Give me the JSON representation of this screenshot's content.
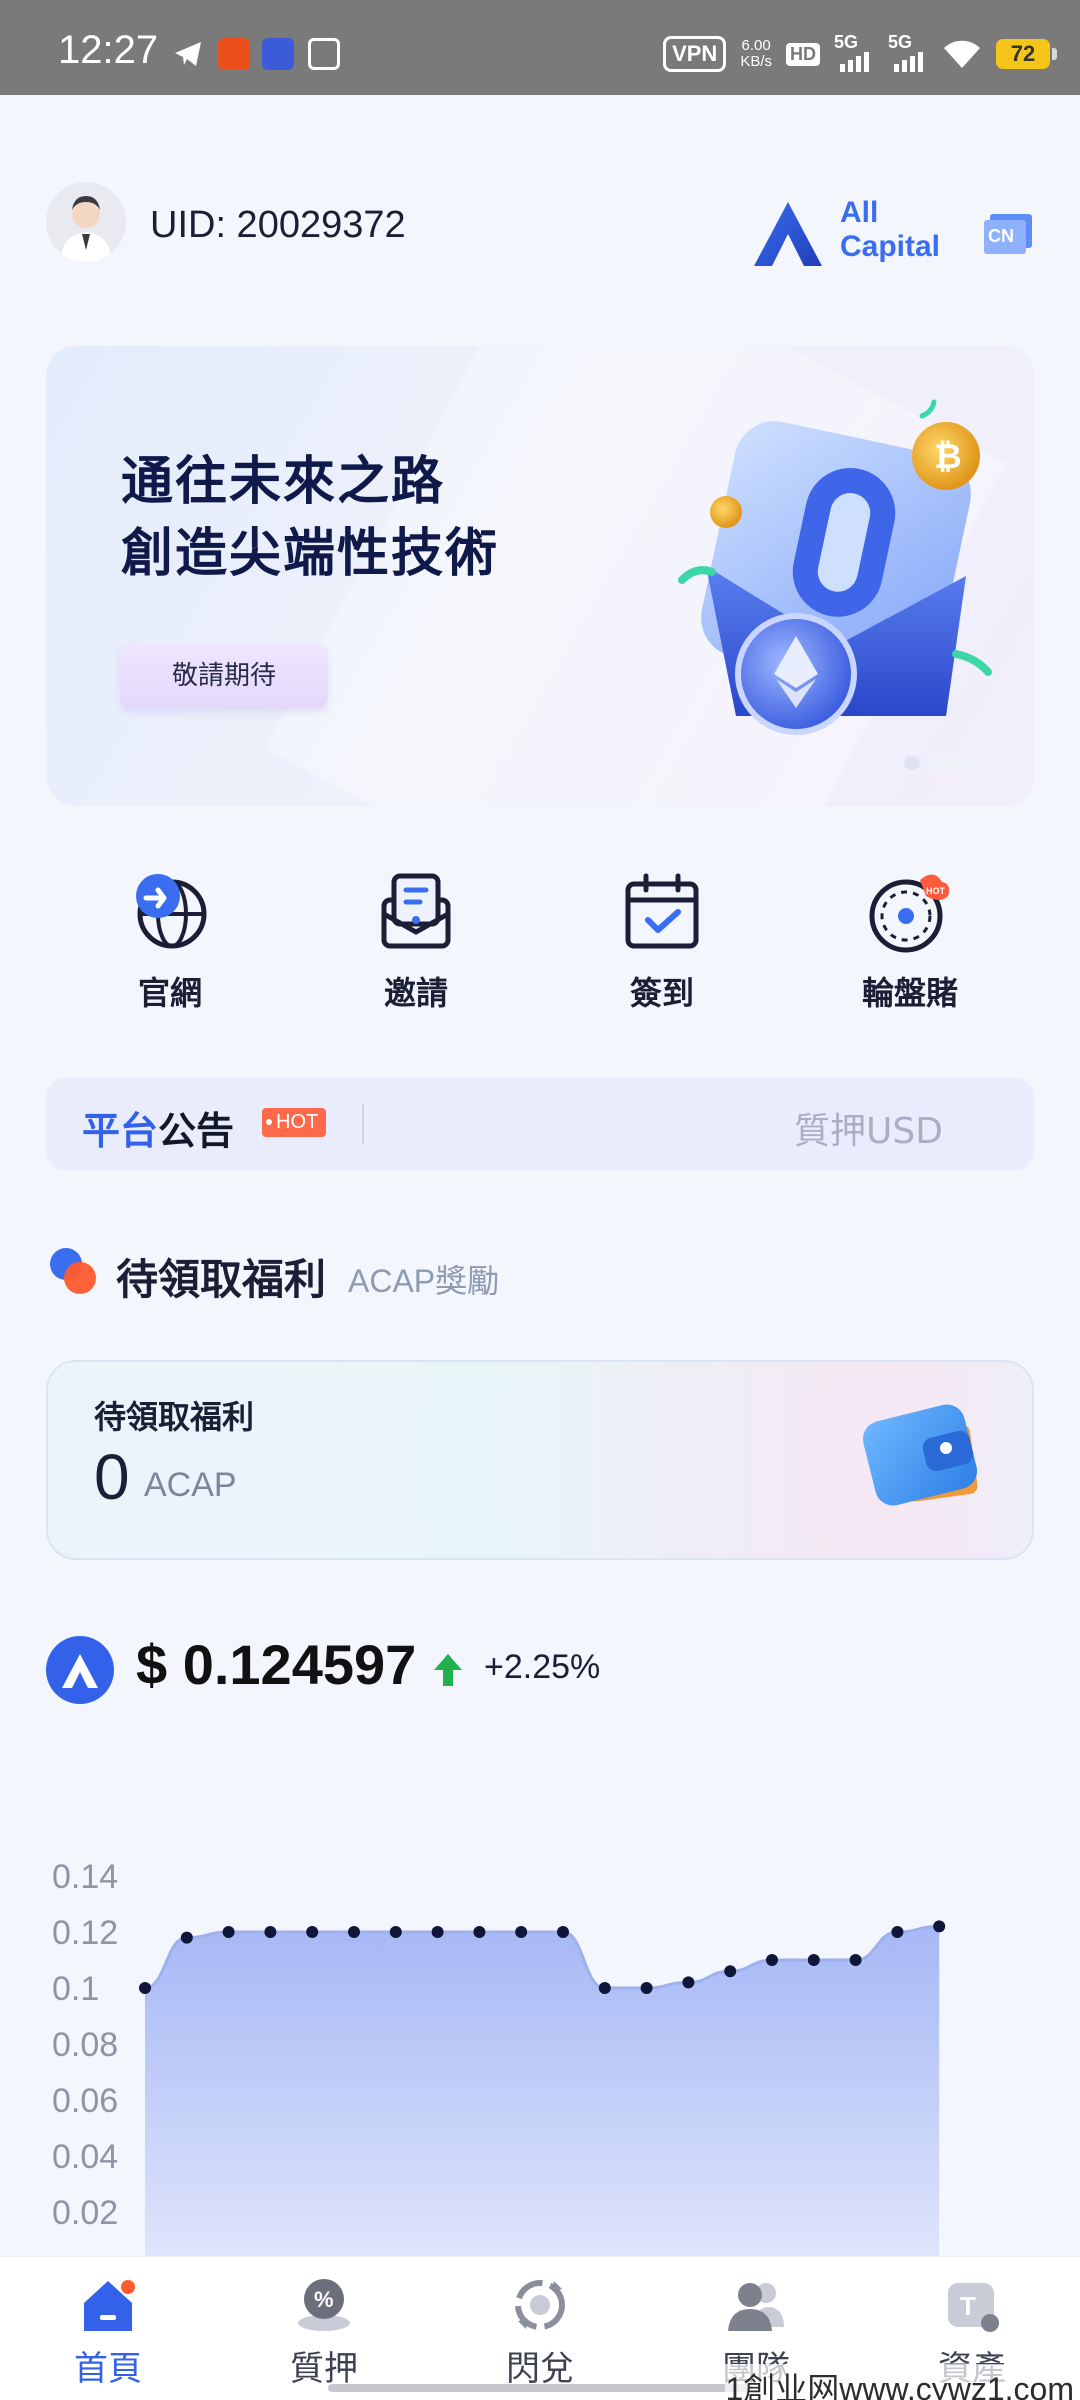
{
  "status_bar": {
    "time": "12:27",
    "vpn": "VPN",
    "speed_value": "6.00",
    "speed_unit": "KB/s",
    "hd": "HD",
    "net1": "5G",
    "net2": "5G",
    "battery": "72"
  },
  "header": {
    "uid": "UID: 20029372",
    "logo_line1": "All",
    "logo_line2": "Capital",
    "lang": "CN"
  },
  "banner": {
    "line1": "通往未來之路",
    "line2": "創造尖端性技術",
    "button": "敬請期待"
  },
  "quick_actions": [
    {
      "label": "官網",
      "icon": "globe-icon"
    },
    {
      "label": "邀請",
      "icon": "invite-icon"
    },
    {
      "label": "簽到",
      "icon": "calendar-check-icon"
    },
    {
      "label": "輪盤賭",
      "icon": "roulette-icon"
    }
  ],
  "notice": {
    "title_part1": "平台",
    "title_part2": "公告",
    "hot": "HOT",
    "text": "質押USD"
  },
  "welfare": {
    "title": "待領取福利",
    "subtitle": "ACAP獎勵",
    "card_label": "待領取福利",
    "value": "0",
    "unit": "ACAP"
  },
  "price": {
    "value": "$ 0.124597",
    "change": "+2.25%",
    "up_color": "#22b14c"
  },
  "chart_data": {
    "type": "area",
    "y_ticks": [
      "0.14",
      "0.12",
      "0.1",
      "0.08",
      "0.06",
      "0.04",
      "0.02"
    ],
    "ylim": [
      0,
      0.14
    ],
    "values": [
      0.1,
      0.118,
      0.12,
      0.12,
      0.12,
      0.12,
      0.12,
      0.12,
      0.12,
      0.12,
      0.12,
      0.1,
      0.1,
      0.102,
      0.106,
      0.11,
      0.11,
      0.11,
      0.12,
      0.122
    ],
    "line_color": "#a9b8f3",
    "fill_color": "#b3c2f8"
  },
  "bottom_nav": [
    {
      "label": "首頁",
      "icon": "home-icon",
      "active": true
    },
    {
      "label": "質押",
      "icon": "stake-icon",
      "active": false
    },
    {
      "label": "閃兌",
      "icon": "exchange-icon",
      "active": false
    },
    {
      "label": "團隊",
      "icon": "team-icon",
      "active": false
    },
    {
      "label": "資產",
      "icon": "assets-icon",
      "active": false
    }
  ],
  "watermark": "1創业网www.cywz1.com",
  "colors": {
    "accent": "#3461ea",
    "background": "#f4f6fd"
  }
}
